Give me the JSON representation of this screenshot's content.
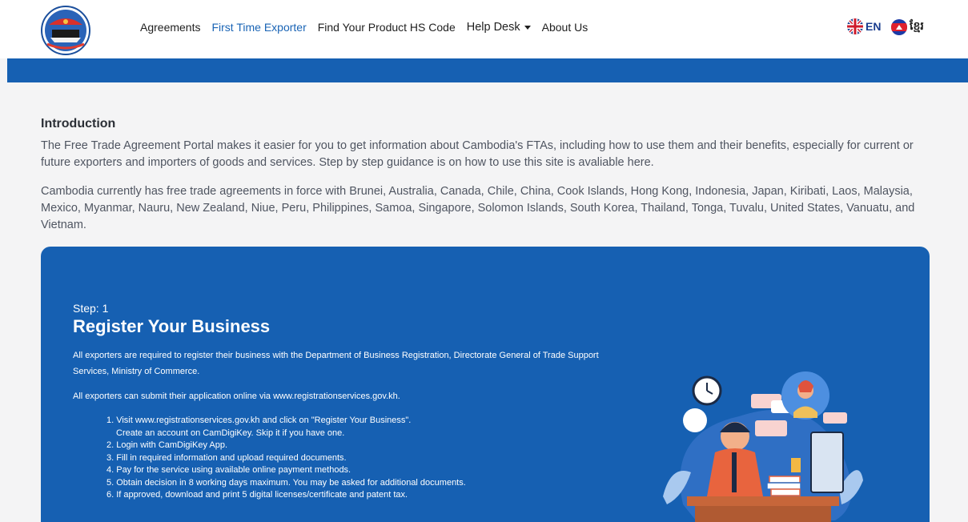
{
  "nav": {
    "links": [
      "Agreements",
      "First Time Exporter",
      "Find Your Product HS Code",
      "Help Desk",
      "About Us"
    ],
    "lang_en": "EN",
    "lang_kh": "ខ្មែរ"
  },
  "intro": {
    "title": "Introduction",
    "p1": "The Free Trade Agreement Portal makes it easier for you to get information about Cambodia's FTAs, including how to use them and their benefits, especially for current or future exporters and importers of goods and services. Step by step guidance is on how to use this site is avaliable here.",
    "p2": "Cambodia currently has free trade agreements in force with Brunei, Australia, Canada, Chile, China, Cook Islands, Hong Kong, Indonesia, Japan, Kiribati, Laos, Malaysia, Mexico, Myanmar, Nauru, New Zealand, Niue, Peru, Philippines, Samoa, Singapore, Solomon Islands, South Korea, Thailand, Tonga, Tuvalu, United States, Vanuatu, and Vietnam."
  },
  "step": {
    "label": "Step: 1",
    "title": "Register Your Business",
    "desc": "All exporters are required to register their business with the Department of Business Registration, Directorate General of Trade Support Services, Ministry of Commerce.",
    "online": "All exporters can submit their application online via www.registrationservices.gov.kh.",
    "list": [
      "1. Visit www.registrationservices.gov.kh and click on \"Register Your Business\".",
      "Create an account on CamDigiKey. Skip it if you have one.",
      "2. Login with CamDigiKey App.",
      "3. Fill in required information and upload required documents.",
      "4. Pay for the service using available online payment methods.",
      "5. Obtain decision in 8 working days maximum. You may be asked for additional documents.",
      "6. If approved, download and print 5 digital licenses/certificate and patent tax."
    ]
  },
  "colors": {
    "brand_blue": "#1660b2",
    "nav_active": "#1a64b5",
    "page_bg": "#f4f4f5"
  },
  "icons": [
    "ministry-logo-icon",
    "uk-flag-icon",
    "cambodia-flag-icon",
    "chevron-down-icon",
    "call-center-illustration"
  ]
}
